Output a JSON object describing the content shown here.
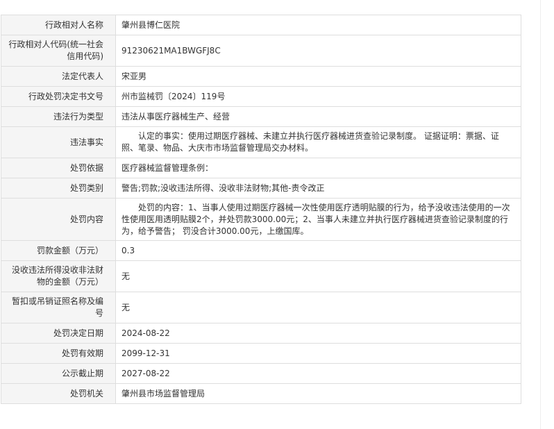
{
  "records": {
    "admin_party_name_label": "行政相对人名称",
    "admin_party_name": "肇州县博仁医院",
    "credit_code_label": "行政相对人代码(统一社会信用代码)",
    "credit_code": "91230621MA1BWGFJ8C",
    "legal_rep_label": "法定代表人",
    "legal_rep": "宋亚男",
    "decision_doc_no_label": "行政处罚决定书文号",
    "decision_doc_no": "州市监械罚〔2024〕119号",
    "violation_type_label": "违法行为类型",
    "violation_type": "违法从事医疗器械生产、经营",
    "violation_facts_label": "违法事实",
    "violation_facts": "认定的事实：使用过期医疗器械、未建立并执行医疗器械进货查验记录制度。 证据证明：票据、证照、笔录、物品、大庆市市场监督管理局交办材料。",
    "penalty_basis_label": "处罚依据",
    "penalty_basis": "医疗器械监督管理条例：",
    "penalty_category_label": "处罚类别",
    "penalty_category": "警告;罚款;没收违法所得、没收非法财物;其他-责令改正",
    "penalty_content_label": "处罚内容",
    "penalty_content": "处罚的内容：1、当事人使用过期医疗器械一次性使用医疗透明贴膜的行为，给予没收违法使用的一次性使用医用透明贴膜2个，并处罚款3000.00元；2、当事人未建立并执行医疗器械进货查验记录制度的行为，给予警告； 罚没合计3000.00元，上缴国库。",
    "fine_amount_label": "罚款金额（万元）",
    "fine_amount": "0.3",
    "confiscation_amount_label": "没收违法所得没收非法财物的金额（万元）",
    "confiscation_amount": "无",
    "license_revocation_label": "暂扣或吊销证照名称及编号",
    "license_revocation": "无",
    "decision_date_label": "处罚决定日期",
    "decision_date": "2024-08-22",
    "validity_label": "处罚有效期",
    "validity": "2099-12-31",
    "publicity_deadline_label": "公示截止期",
    "publicity_deadline": "2027-08-22",
    "authority_label": "处罚机关",
    "authority": "肇州县市场监督管理局"
  }
}
